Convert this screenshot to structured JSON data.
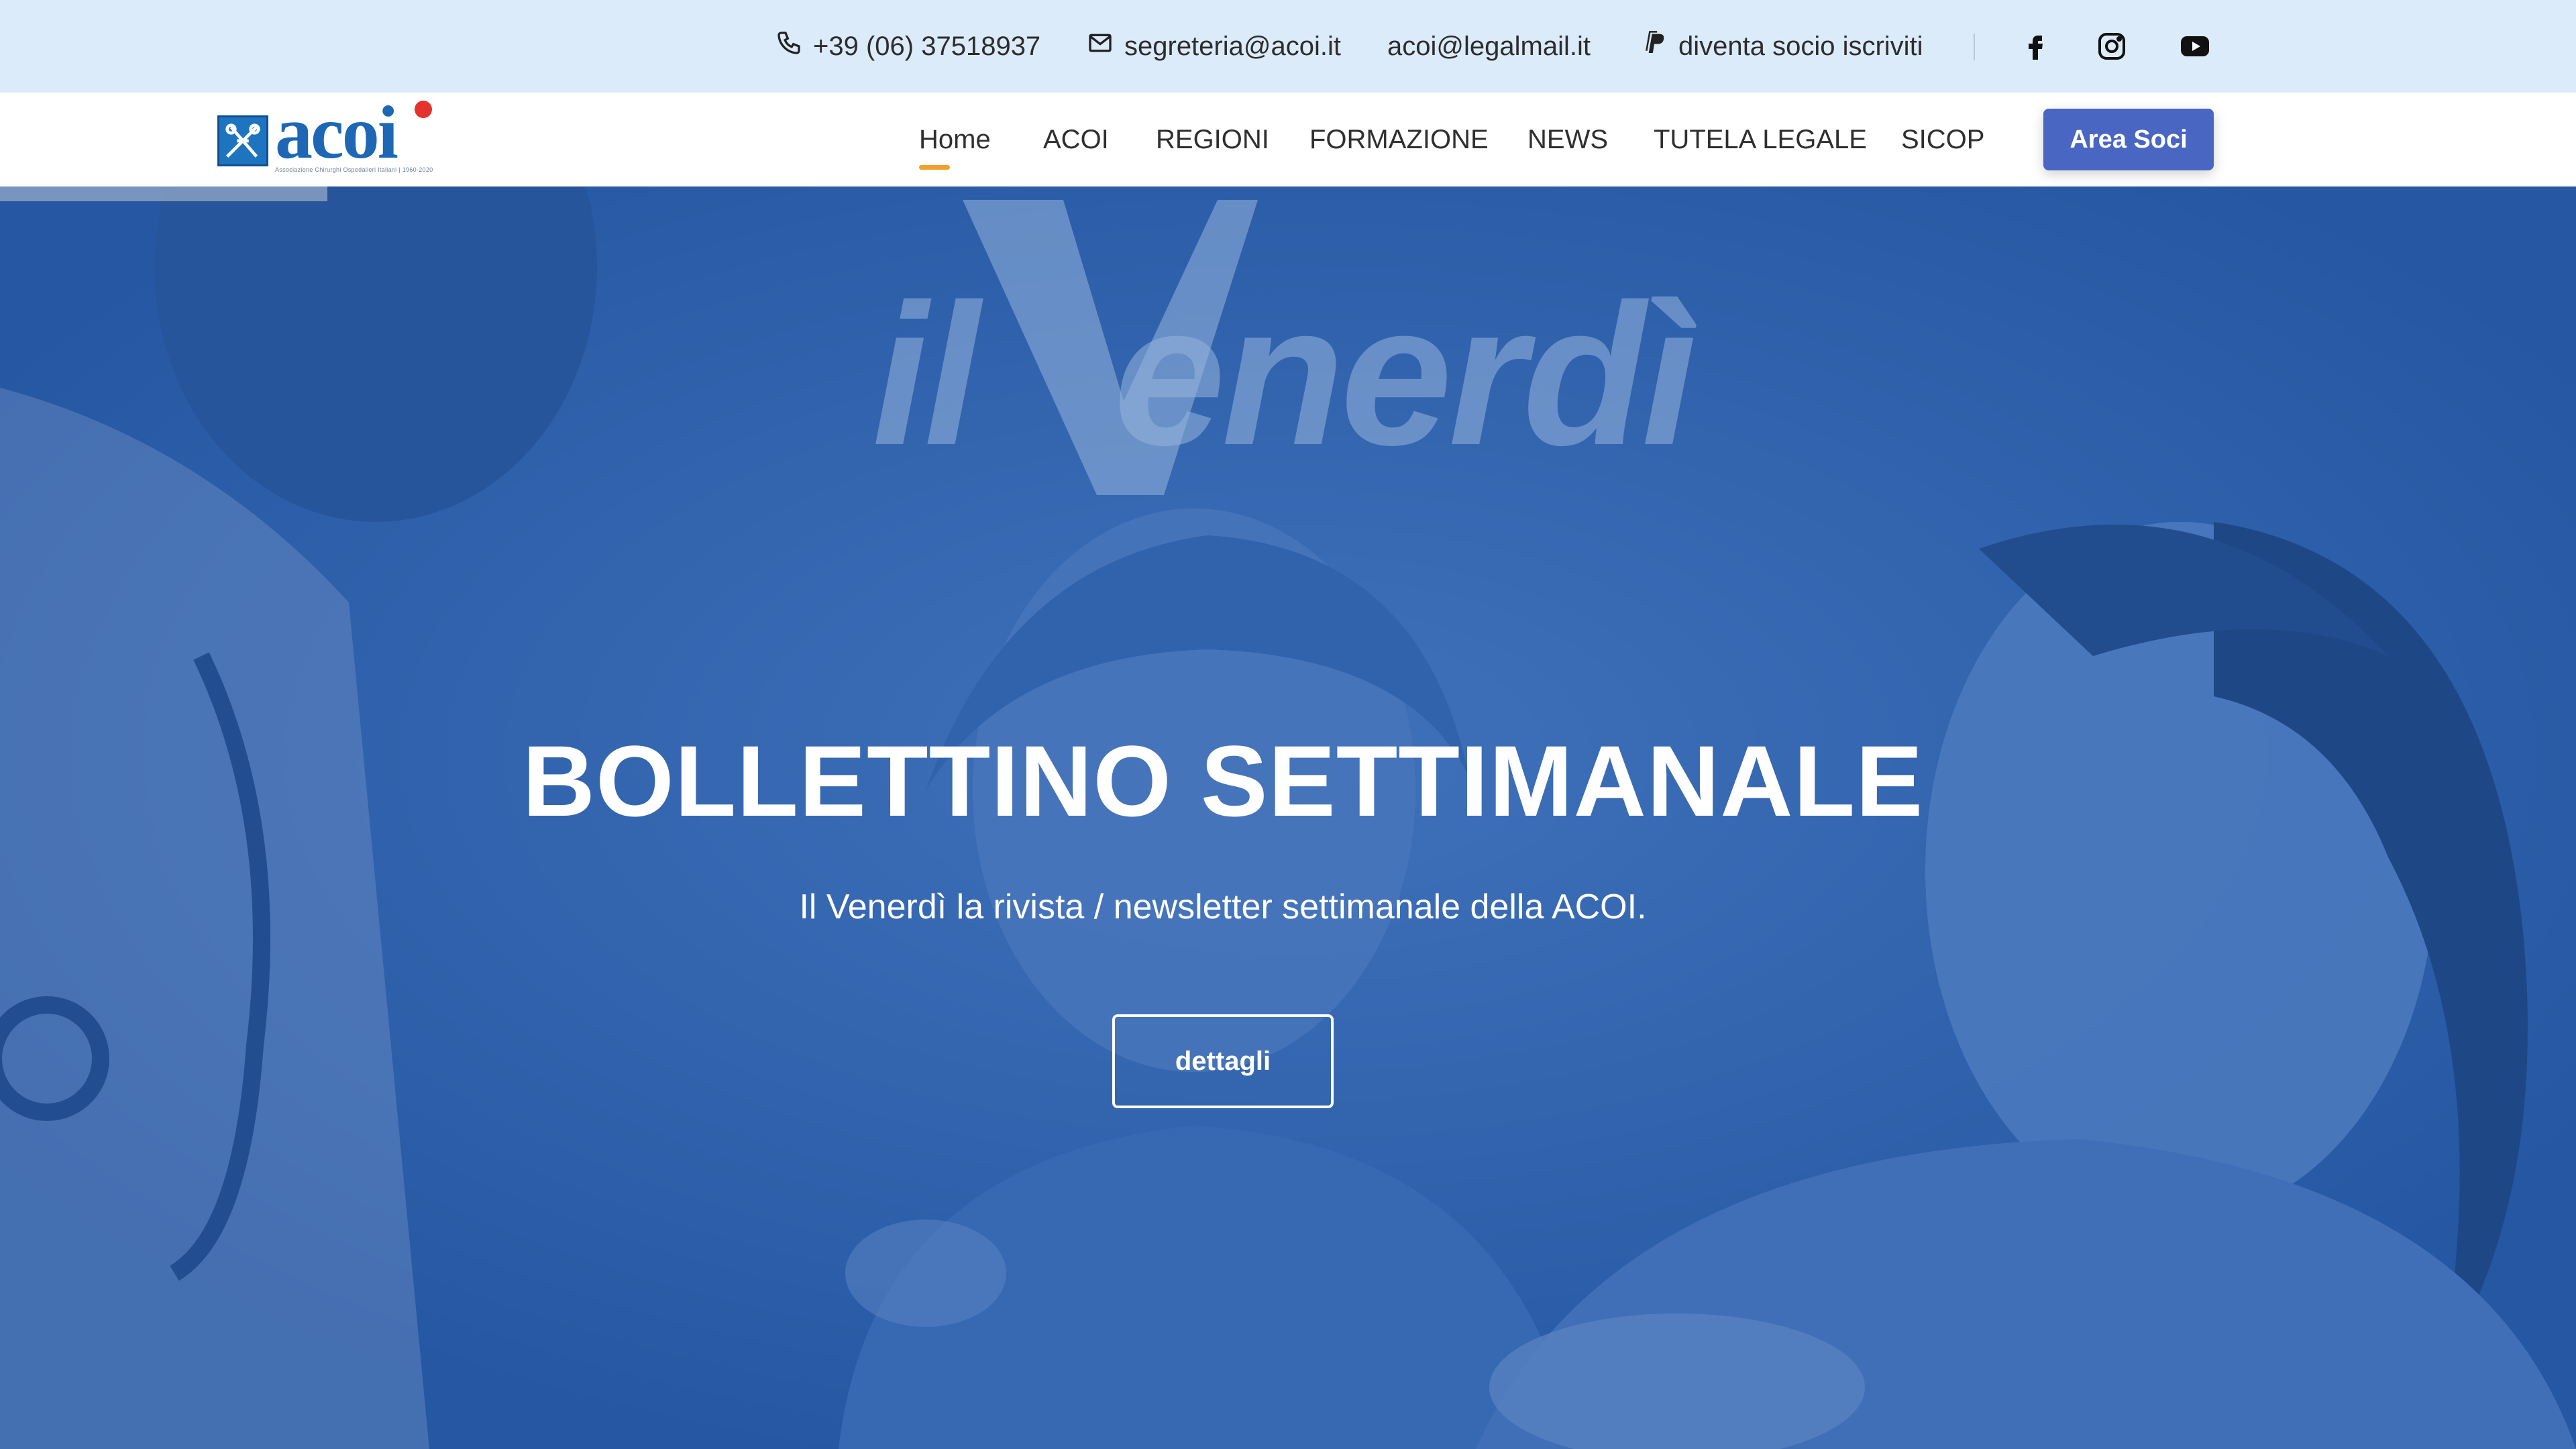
{
  "topbar": {
    "phone": "+39 (06) 37518937",
    "email": "segreteria@acoi.it",
    "pec": "acoi@legalmail.it",
    "join": "diventa socio iscriviti",
    "social": [
      "facebook-icon",
      "instagram-icon",
      "youtube-icon"
    ]
  },
  "logo": {
    "word": "acoi",
    "tagline": "Associazione Chirurghi Ospedalieri Italiani | 1960-2020"
  },
  "nav": {
    "items": [
      {
        "label": "Home",
        "active": true
      },
      {
        "label": "ACOI",
        "active": false
      },
      {
        "label": "REGIONI",
        "active": false
      },
      {
        "label": "FORMAZIONE",
        "active": false
      },
      {
        "label": "NEWS",
        "active": false
      },
      {
        "label": "TUTELA LEGALE",
        "active": false
      },
      {
        "label": "SICOP",
        "active": false
      }
    ],
    "cta": "Area Soci"
  },
  "hero": {
    "brand_il": "il",
    "brand_v": "V",
    "brand_rest": "enerdì",
    "title": "BOLLETTINO SETTIMANALE",
    "subtitle": "Il Venerdì la rivista / newsletter settimanale della ACOI.",
    "button": "dettagli"
  },
  "colors": {
    "topbar_bg": "#dcebfa",
    "nav_accent": "#f0a02c",
    "cta_bg": "#4966c3",
    "hero_blue": "#2b61ac"
  }
}
